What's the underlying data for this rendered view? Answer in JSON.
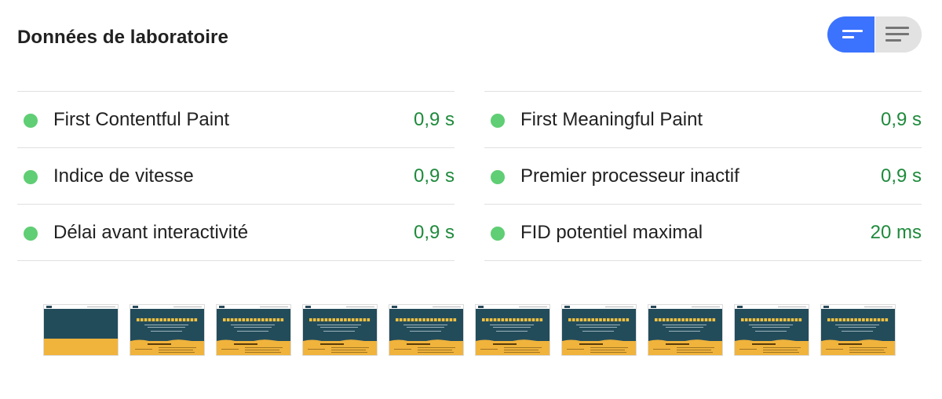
{
  "header": {
    "title": "Données de laboratoire"
  },
  "view_toggle": {
    "active": "summary",
    "accent_color": "#3b73ff"
  },
  "metrics": {
    "left": [
      {
        "label": "First Contentful Paint",
        "value": "0,9 s",
        "status": "good"
      },
      {
        "label": "Indice de vitesse",
        "value": "0,9 s",
        "status": "good"
      },
      {
        "label": "Délai avant interactivité",
        "value": "0,9 s",
        "status": "good"
      }
    ],
    "right": [
      {
        "label": "First Meaningful Paint",
        "value": "0,9 s",
        "status": "good"
      },
      {
        "label": "Premier processeur inactif",
        "value": "0,9 s",
        "status": "good"
      },
      {
        "label": "FID potentiel maximal",
        "value": "20 ms",
        "status": "good"
      }
    ]
  },
  "colors": {
    "good_dot": "#5fce74",
    "good_value": "#1e8a3c"
  },
  "filmstrip": {
    "frame_count": 10,
    "frames_with_content": [
      false,
      true,
      true,
      true,
      true,
      true,
      true,
      true,
      true,
      true
    ],
    "colors": {
      "hero": "#234c5b",
      "band": "#f0b33c",
      "headline": "#f0c040"
    }
  }
}
